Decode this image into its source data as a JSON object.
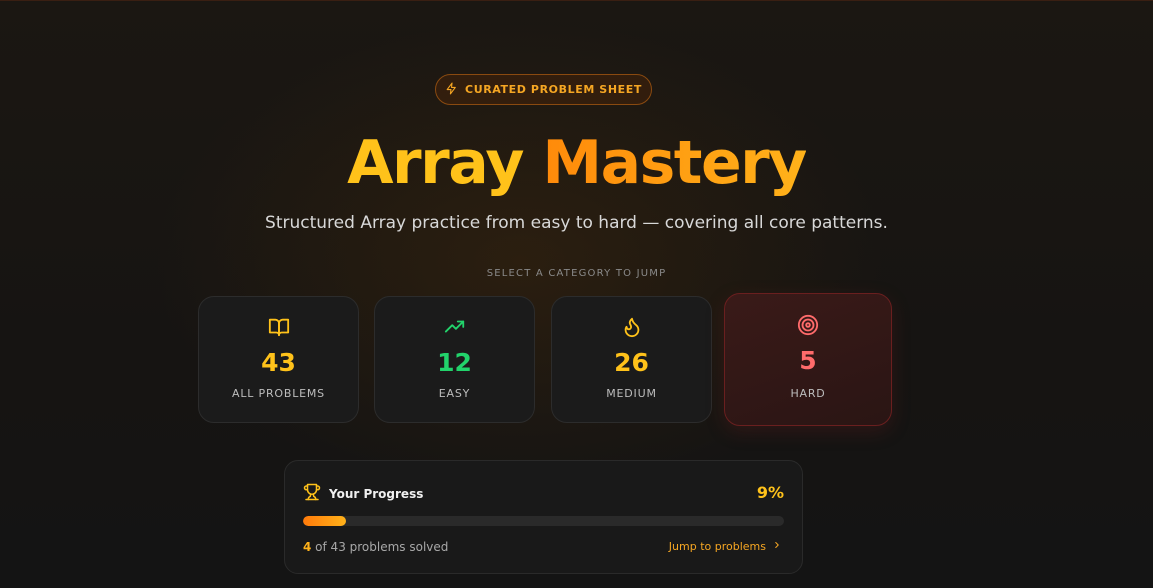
{
  "header": {
    "badge_label": "CURATED PROBLEM SHEET",
    "badge_icon": "lightning-icon",
    "title_word1": "Array",
    "title_word2": "Mastery",
    "subtitle": "Structured Array practice from easy to hard — covering all core patterns.",
    "category_hint": "SELECT A CATEGORY TO JUMP"
  },
  "categories": [
    {
      "icon": "book-open-icon",
      "count": "43",
      "label": "ALL PROBLEMS",
      "color": "#ffc21a"
    },
    {
      "icon": "trending-up-icon",
      "count": "12",
      "label": "EASY",
      "color": "#22d36b"
    },
    {
      "icon": "flame-icon",
      "count": "26",
      "label": "MEDIUM",
      "color": "#ffc21a"
    },
    {
      "icon": "target-icon",
      "count": "5",
      "label": "HARD",
      "color": "#ff6b6b"
    }
  ],
  "progress": {
    "title": "Your Progress",
    "icon": "trophy-icon",
    "percent_label": "9%",
    "percent": 9,
    "solved": "4",
    "total_text": " of 43 problems solved",
    "link_label": "Jump to problems"
  },
  "colors": {
    "accent": "#ffc21a",
    "accent_orange": "#ff8a0a",
    "easy": "#22d36b",
    "hard": "#ff6b6b",
    "background": "#141414"
  }
}
